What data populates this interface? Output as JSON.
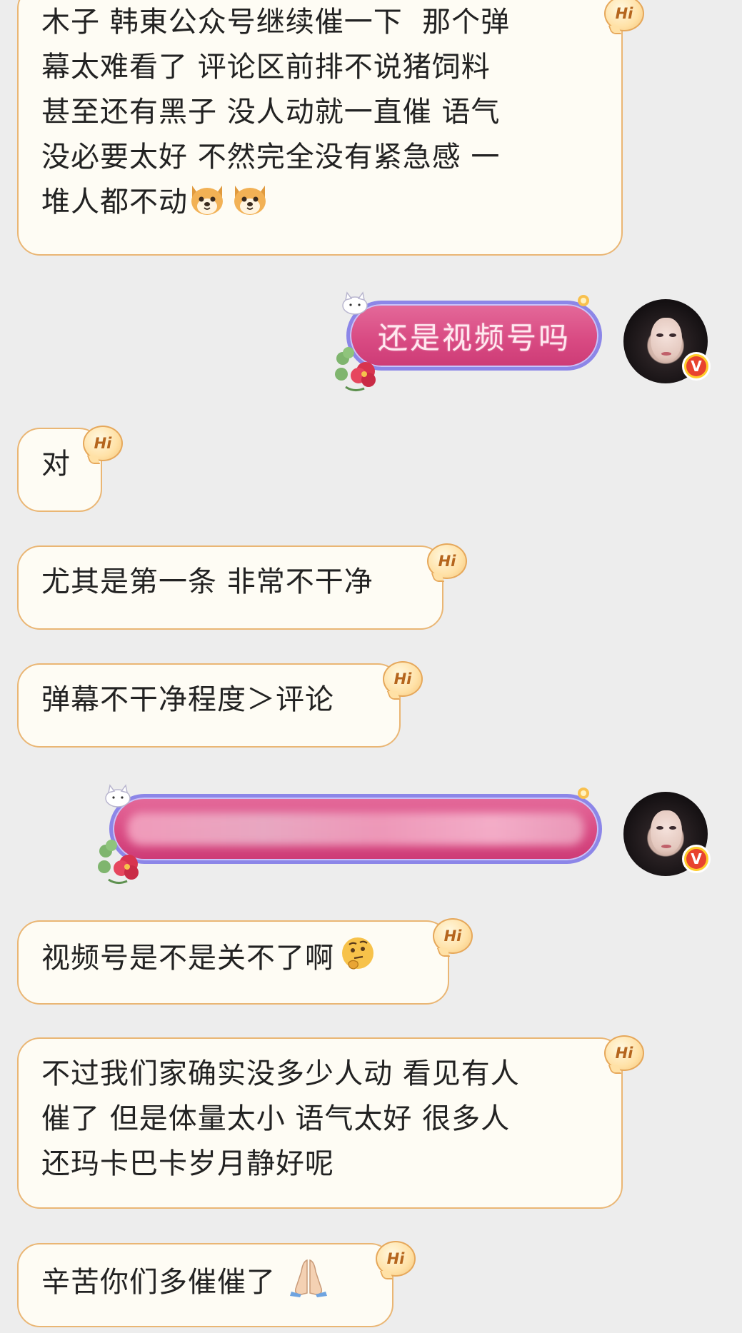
{
  "messages": [
    {
      "text": "木子 韩東公众号继续催一下  那个弹\n幕太难看了 评论区前排不说猪饲料\n甚至还有黑子 没人动就一直催 语气\n没必要太好 不然完全没有紧急感 一\n堆人都不动",
      "emoji": [
        "dog-face",
        "dog-face"
      ]
    },
    {
      "text": "还是视频号吗"
    },
    {
      "text": "对"
    },
    {
      "text": "尤其是第一条 非常不干净"
    },
    {
      "text": "弹幕不干净程度＞评论"
    },
    {
      "text": "视频号是不是关不了啊",
      "emoji": [
        "thinking-face"
      ]
    },
    {
      "text": "不过我们家确实没多少人动 看见有人\n催了 但是体量太小 语气太好 很多人\n还玛卡巴卡岁月静好呢"
    },
    {
      "text": "辛苦你们多催催了",
      "emoji": [
        "folded-hands"
      ]
    }
  ],
  "badge": {
    "hi_label": "Hi",
    "verified_label": "V"
  },
  "colors": {
    "background": "#ededed",
    "incoming_bubble": "#fefcf4",
    "incoming_border": "#eab674",
    "outgoing_bubble": "#d94b83",
    "outgoing_border": "#8c86e8"
  }
}
